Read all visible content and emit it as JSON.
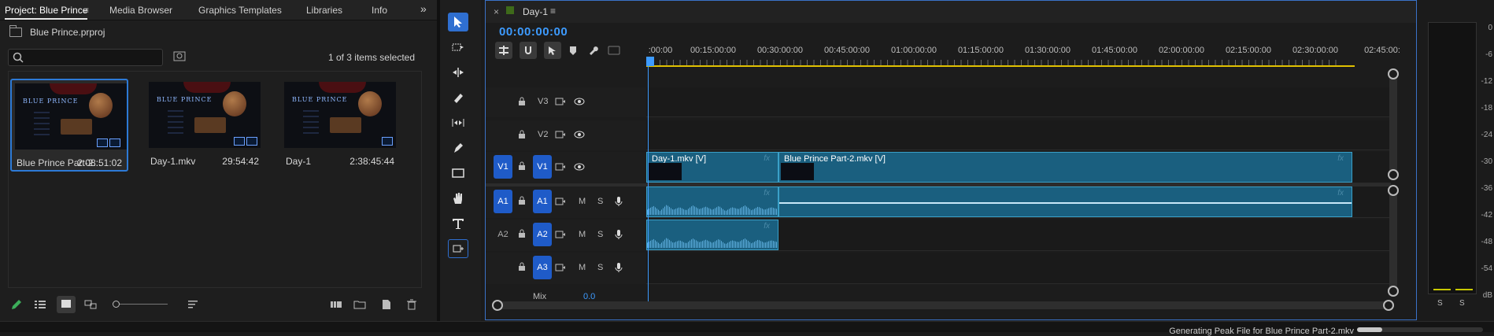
{
  "project_panel": {
    "tabs": [
      {
        "label": "Project: Blue Prince",
        "active": true
      },
      {
        "label": "Media Browser"
      },
      {
        "label": "Graphics Templates"
      },
      {
        "label": "Libraries"
      },
      {
        "label": "Info"
      }
    ],
    "overflow_label": "»",
    "project_file": "Blue Prince.prproj",
    "search_placeholder": "",
    "selection_status": "1 of 3 items selected",
    "items": [
      {
        "name": "Blue Prince Part-2...",
        "duration": "2:08:51:02",
        "selected": true,
        "thumb_logo": "BLUE PRINCE"
      },
      {
        "name": "Day-1.mkv",
        "duration": "29:54:42",
        "selected": false,
        "thumb_logo": "BLUE PRINCE"
      },
      {
        "name": "Day-1",
        "duration": "2:38:45:44",
        "selected": false,
        "thumb_logo": "BLUE PRINCE"
      }
    ]
  },
  "timeline": {
    "sequence_name": "Day-1",
    "close_label": "×",
    "menu_label": "≡",
    "timecode": "00:00:00:00",
    "ruler_labels": [
      ":00:00",
      "00:15:00:00",
      "00:30:00:00",
      "00:45:00:00",
      "01:00:00:00",
      "01:15:00:00",
      "01:30:00:00",
      "01:45:00:00",
      "02:00:00:00",
      "02:15:00:00",
      "02:30:00:00",
      "02:45:00:"
    ],
    "tracks": [
      {
        "id": "V3",
        "source": "",
        "label": "V3",
        "kind": "video"
      },
      {
        "id": "V2",
        "source": "",
        "label": "V2",
        "kind": "video"
      },
      {
        "id": "V1",
        "source": "V1",
        "label": "V1",
        "kind": "video"
      },
      {
        "id": "A1",
        "source": "A1",
        "label": "A1",
        "kind": "audio"
      },
      {
        "id": "A2",
        "source": "A2",
        "label": "A2",
        "kind": "audio"
      },
      {
        "id": "A3",
        "source": "",
        "label": "A3",
        "kind": "audio"
      }
    ],
    "mute_label": "M",
    "solo_label": "S",
    "fx_label": "fx",
    "clips": {
      "v1_a": "Day-1.mkv [V]",
      "v1_b": "Blue Prince Part-2.mkv [V]"
    },
    "mix_label": "Mix",
    "mix_value": "0.0"
  },
  "meters": {
    "db_labels": [
      "0",
      "-6",
      "-12",
      "-18",
      "-24",
      "-30",
      "-36",
      "-42",
      "-48",
      "-54",
      "dB"
    ],
    "solo_left": "S",
    "solo_right": "S"
  },
  "status": {
    "text": "Generating Peak File for Blue Prince Part-2.mkv",
    "progress": 0.2
  },
  "colors": {
    "accent": "#2f6fd0",
    "timecode": "#3d9bff",
    "clip": "#1a5f7f",
    "work_area": "#e0c000"
  }
}
